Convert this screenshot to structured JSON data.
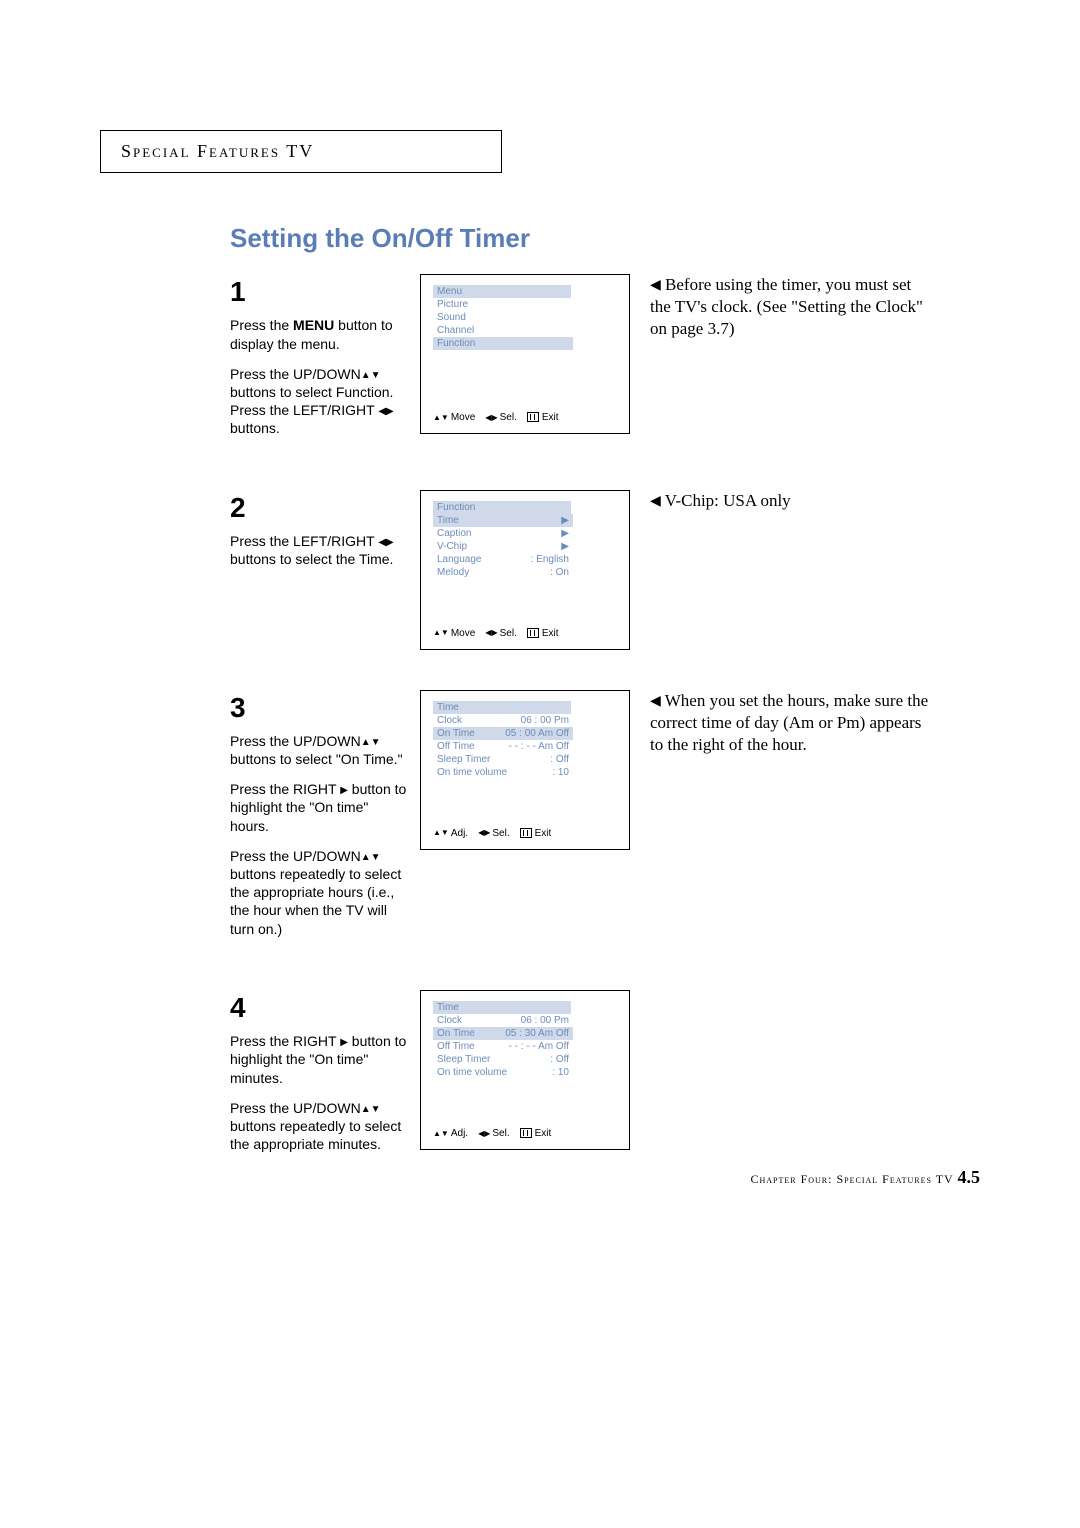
{
  "header": "Special Features TV",
  "title": "Setting the On/Off Timer",
  "steps": [
    {
      "num": "1",
      "lines": [
        "Press the <strong>MENU</strong> button to display the menu.",
        "Press the UP/DOWN<span class='inline-icon'>▲▼</span> buttons to select Function. Press the LEFT/RIGHT <span class='inline-icon'>◀▶</span> buttons."
      ],
      "osd": {
        "title": "Menu",
        "items": [
          {
            "label": "Picture",
            "val": "",
            "sel": false
          },
          {
            "label": "Sound",
            "val": "",
            "sel": false
          },
          {
            "label": "Channel",
            "val": "",
            "sel": false
          },
          {
            "label": "Function",
            "val": "",
            "sel": true
          }
        ],
        "footer": [
          "Move",
          "Sel.",
          "Exit"
        ],
        "footicons": [
          "updown",
          "leftright",
          "exit"
        ]
      },
      "note": "Before using the timer, you must set the TV's clock. (See \"Setting the Clock\" on page 3.7)"
    },
    {
      "num": "2",
      "lines": [
        "Press the LEFT/RIGHT <span class='inline-icon'>◀▶</span> buttons to select the Time."
      ],
      "osd": {
        "title": "Function",
        "items": [
          {
            "label": "Time",
            "val": "▶",
            "sel": true
          },
          {
            "label": "Caption",
            "val": "▶",
            "sel": false
          },
          {
            "label": "V-Chip",
            "val": "▶",
            "sel": false
          },
          {
            "label": "Language",
            "val": ": English",
            "sel": false
          },
          {
            "label": "Melody",
            "val": ": On",
            "sel": false
          }
        ],
        "footer": [
          "Move",
          "Sel.",
          "Exit"
        ],
        "footicons": [
          "updown",
          "leftright",
          "exit"
        ]
      },
      "note": "V-Chip: USA only"
    },
    {
      "num": "3",
      "lines": [
        "Press the UP/DOWN<span class='inline-icon'>▲▼</span> buttons to select \"On Time.\"",
        "Press the RIGHT <span class='inline-icon'>▶</span> button to highlight the \"On time\" hours.",
        "Press the UP/DOWN<span class='inline-icon'>▲▼</span> buttons repeatedly to select the appropriate hours (i.e., the hour when the TV will turn on.)"
      ],
      "osd": {
        "title": "Time",
        "items": [
          {
            "label": "Clock",
            "val": "06 : 00 Pm",
            "sel": false
          },
          {
            "label": "On Time",
            "val": "05 : 00 Am  Off",
            "sel": true
          },
          {
            "label": "Off Time",
            "val": "- - : - - Am  Off",
            "sel": false
          },
          {
            "label": "Sleep Timer",
            "val": ": Off",
            "sel": false
          },
          {
            "label": "On time volume",
            "val": ":       10",
            "sel": false
          }
        ],
        "footer": [
          "Adj.",
          "Sel.",
          "Exit"
        ],
        "footicons": [
          "updown",
          "leftright",
          "exit"
        ]
      },
      "note": "When you set the hours, make sure the correct time of day (Am or Pm) appears to the right of the hour."
    },
    {
      "num": "4",
      "lines": [
        "Press the RIGHT <span class='inline-icon'>▶</span> button to highlight the \"On time\" minutes.",
        "Press the UP/DOWN<span class='inline-icon'>▲▼</span> buttons repeatedly to select the appropriate minutes."
      ],
      "osd": {
        "title": "Time",
        "items": [
          {
            "label": "Clock",
            "val": "06 : 00 Pm",
            "sel": false
          },
          {
            "label": "On Time",
            "val": "05 : 30 Am  Off",
            "sel": true
          },
          {
            "label": "Off Time",
            "val": "- - : - - Am  Off",
            "sel": false
          },
          {
            "label": "Sleep Timer",
            "val": ": Off",
            "sel": false
          },
          {
            "label": "On time volume",
            "val": ":       10",
            "sel": false
          }
        ],
        "footer": [
          "Adj.",
          "Sel.",
          "Exit"
        ],
        "footicons": [
          "updown",
          "leftright",
          "exit"
        ]
      },
      "note": ""
    }
  ],
  "footer": {
    "chapter": "Chapter Four: Special Features TV",
    "page": "4.5"
  }
}
